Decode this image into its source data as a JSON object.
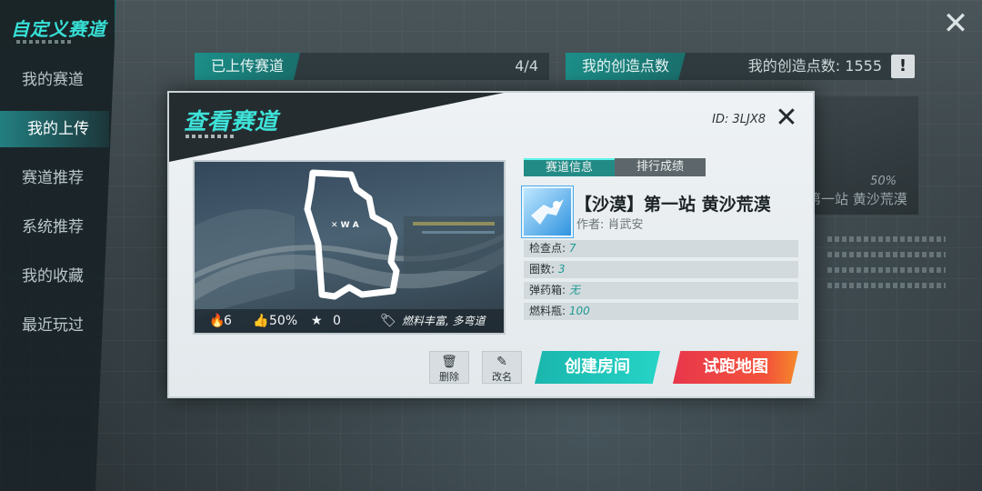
{
  "sidebar": {
    "title": "自定义赛道",
    "items": [
      {
        "label": "我的赛道"
      },
      {
        "label": "我的上传"
      },
      {
        "label": "赛道推荐"
      },
      {
        "label": "系统推荐"
      },
      {
        "label": "我的收藏"
      },
      {
        "label": "最近玩过"
      }
    ],
    "active_index": 1
  },
  "header": {
    "uploaded_label": "已上传赛道",
    "uploaded_value": "4/4",
    "points_tag": "我的创造点数",
    "points_text": "我的创造点数: 1555",
    "alert_glyph": "!"
  },
  "background_card": {
    "name_peek": "第一站 黄沙荒漠",
    "percent": "50%"
  },
  "modal": {
    "title": "查看赛道",
    "track_id": "ID: 3LJX8",
    "tabs": [
      "赛道信息",
      "排行成绩"
    ],
    "track_name": "【沙漠】第一站 黄沙荒漠",
    "author": "作者: 肖武安",
    "preview_stats": {
      "plays": "6",
      "like_rate": "50%",
      "stars": "0",
      "tags": "燃料丰富, 多弯道"
    },
    "info": [
      {
        "label": "检查点:",
        "value": "7"
      },
      {
        "label": "圈数:",
        "value": "3"
      },
      {
        "label": "弹药箱:",
        "value": "无"
      },
      {
        "label": "燃料瓶:",
        "value": "100"
      }
    ],
    "buttons": {
      "delete": "删除",
      "rename": "改名",
      "create_room": "创建房间",
      "test_run": "试跑地图"
    }
  },
  "colors": {
    "accent": "#3ee2d8",
    "create_button": "#1ab6ad",
    "test_button": "#ee4045"
  }
}
